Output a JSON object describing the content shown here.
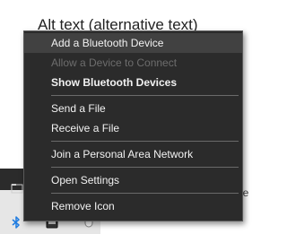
{
  "background": {
    "heading": "Alt text (alternative text)",
    "right_link_fragment": "↗",
    "right_text_fragment": "ive"
  },
  "menu": {
    "items": [
      {
        "label": "Add a Bluetooth Device",
        "state": "hover"
      },
      {
        "label": "Allow a Device to Connect",
        "state": "disabled"
      },
      {
        "label": "Show Bluetooth Devices",
        "state": "bold"
      },
      {
        "label": "Send a File",
        "state": "normal"
      },
      {
        "label": "Receive a File",
        "state": "normal"
      },
      {
        "label": "Join a Personal Area Network",
        "state": "normal"
      },
      {
        "label": "Open Settings",
        "state": "normal"
      },
      {
        "label": "Remove Icon",
        "state": "normal"
      }
    ]
  },
  "taskbar": {
    "icons": [
      "folder-icon",
      "bluetooth-icon",
      "tablet-icon",
      "mouse-icon"
    ]
  },
  "colors": {
    "menu_bg": "#2b2b2b",
    "menu_hover": "#414141",
    "menu_text": "#f2f2f2",
    "menu_disabled": "#6d6d6d",
    "separator": "#6a6a6a"
  }
}
